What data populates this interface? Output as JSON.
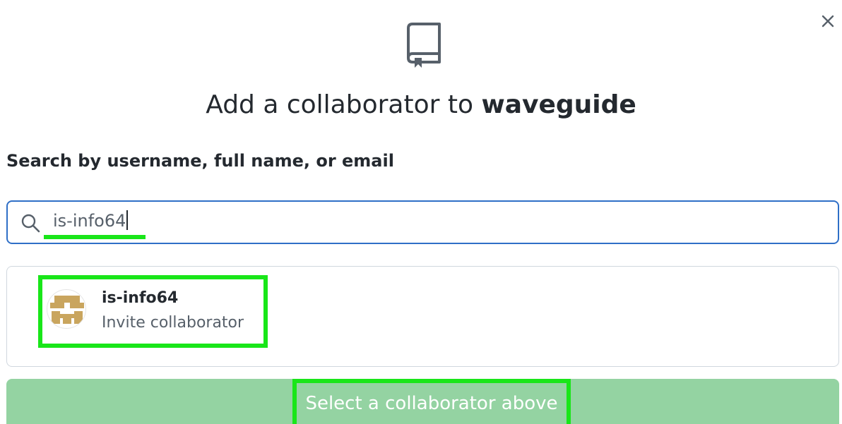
{
  "dialog": {
    "close_icon": "close-icon",
    "header_icon": "repo-icon",
    "title_prefix": "Add a collaborator to ",
    "title_repo": "waveguide"
  },
  "search": {
    "label": "Search by username, full name, or email",
    "value": "is-info64",
    "icon": "search-icon"
  },
  "results": [
    {
      "username": "is-info64",
      "action": "Invite collaborator",
      "avatar": "identicon-avatar"
    }
  ],
  "submit": {
    "label": "Select a collaborator above",
    "color": "#94d3a2"
  },
  "colors": {
    "focus_border": "#2f6fc7",
    "annotation_highlight": "#19e619",
    "avatar_tan": "#c9a55e"
  }
}
